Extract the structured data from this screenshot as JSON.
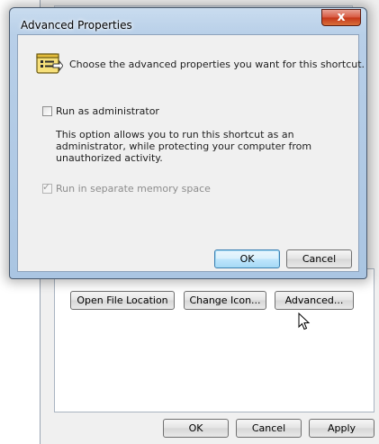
{
  "dialog": {
    "title": "Advanced Properties",
    "close_glyph": "x",
    "intro": "Choose the advanced properties you want for this shortcut.",
    "run_as_admin": {
      "label": "Run as administrator",
      "checked": false
    },
    "description": "This option allows you to run this shortcut as an administrator, while protecting your computer from unauthorized activity.",
    "run_separate_memory": {
      "label": "Run in separate memory space",
      "checked": true,
      "enabled": false
    },
    "ok_label": "OK",
    "cancel_label": "Cancel"
  },
  "properties": {
    "open_file_location_label": "Open File Location",
    "change_icon_label": "Change Icon...",
    "advanced_label": "Advanced...",
    "ok_label": "OK",
    "cancel_label": "Cancel",
    "apply_label": "Apply"
  },
  "icons": {
    "dialog_icon": "properties-icon",
    "cursor": "arrow-cursor-icon"
  },
  "colors": {
    "frame": "#b8cfe8",
    "close_button": "#c43519",
    "client": "#f0f0f0",
    "default_button_border": "#3c7fb1"
  }
}
